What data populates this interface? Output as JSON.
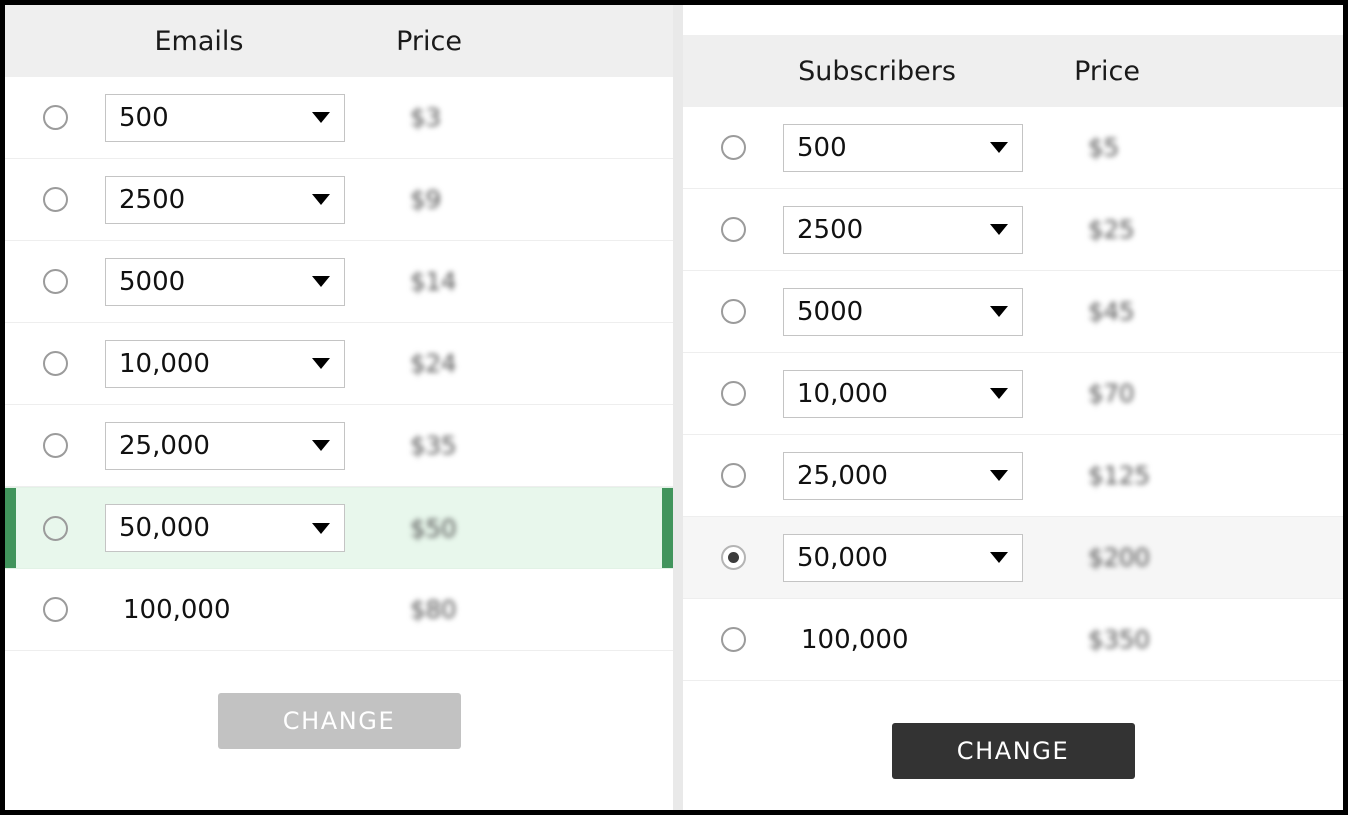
{
  "theme": {
    "frame_color": "#000000",
    "header_bg": "#efefef",
    "accent_green": "#41945c",
    "selected_green_bg": "#e8f7ec",
    "selected_gray_bg": "#f6f6f6",
    "button_enabled_bg": "#333333",
    "button_disabled_bg": "#c2c2c2"
  },
  "left_panel": {
    "name": "emails-plan-table",
    "columns": {
      "radio": "",
      "amount": "Emails",
      "price": "Price"
    },
    "rows": [
      {
        "amount": "500",
        "price": "$3",
        "control": "select",
        "selected": false
      },
      {
        "amount": "2500",
        "price": "$9",
        "control": "select",
        "selected": false
      },
      {
        "amount": "5000",
        "price": "$14",
        "control": "select",
        "selected": false
      },
      {
        "amount": "10,000",
        "price": "$24",
        "control": "select",
        "selected": false
      },
      {
        "amount": "25,000",
        "price": "$35",
        "control": "select",
        "selected": false
      },
      {
        "amount": "50,000",
        "price": "$50",
        "control": "select",
        "selected": false,
        "highlight": "green"
      },
      {
        "amount": "100,000",
        "price": "$80",
        "control": "text",
        "selected": false
      }
    ],
    "button": {
      "label": "CHANGE",
      "state": "disabled"
    }
  },
  "right_panel": {
    "name": "subscribers-plan-table",
    "columns": {
      "radio": "",
      "amount": "Subscribers",
      "price": "Price"
    },
    "rows": [
      {
        "amount": "500",
        "price": "$5",
        "control": "select",
        "selected": false
      },
      {
        "amount": "2500",
        "price": "$25",
        "control": "select",
        "selected": false
      },
      {
        "amount": "5000",
        "price": "$45",
        "control": "select",
        "selected": false
      },
      {
        "amount": "10,000",
        "price": "$70",
        "control": "select",
        "selected": false
      },
      {
        "amount": "25,000",
        "price": "$125",
        "control": "select",
        "selected": false
      },
      {
        "amount": "50,000",
        "price": "$200",
        "control": "select",
        "selected": true,
        "highlight": "gray"
      },
      {
        "amount": "100,000",
        "price": "$350",
        "control": "text",
        "selected": false
      }
    ],
    "button": {
      "label": "CHANGE",
      "state": "enabled"
    }
  }
}
